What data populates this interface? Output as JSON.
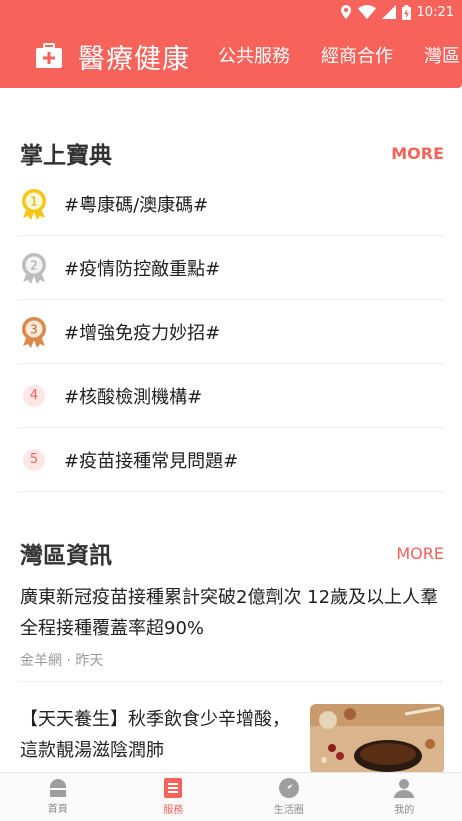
{
  "status_bar": {
    "time": "10:21"
  },
  "header": {
    "title": "醫療健康",
    "nav": [
      "公共服務",
      "經商合作",
      "灣區"
    ]
  },
  "handbook": {
    "title": "掌上寶典",
    "more": "MORE",
    "items": [
      {
        "rank": "1",
        "text": "#粵康碼/澳康碼#"
      },
      {
        "rank": "2",
        "text": "#疫情防控敵重點#"
      },
      {
        "rank": "3",
        "text": "#增強免疫力妙招#"
      },
      {
        "rank": "4",
        "text": "#核酸檢測機構#"
      },
      {
        "rank": "5",
        "text": "#疫苗接種常見問題#"
      }
    ]
  },
  "news": {
    "title": "灣區資訊",
    "more": "MORE",
    "items": [
      {
        "title": "廣東新冠疫苗接種累計突破2億劑次 12歲及以上人羣全程接種覆蓋率超90%",
        "source": "金羊網",
        "time": "昨天"
      },
      {
        "title": "【天天養生】秋季飲食少辛增酸，這款靚湯滋陰潤肺"
      }
    ]
  },
  "tabbar": {
    "items": [
      {
        "label": "首頁"
      },
      {
        "label": "服務"
      },
      {
        "label": "生活圈"
      },
      {
        "label": "我的"
      }
    ]
  },
  "colors": {
    "accent": "#f7625a",
    "gold": "#f5c518",
    "silver": "#bdbdbd",
    "bronze": "#d98a4a"
  }
}
